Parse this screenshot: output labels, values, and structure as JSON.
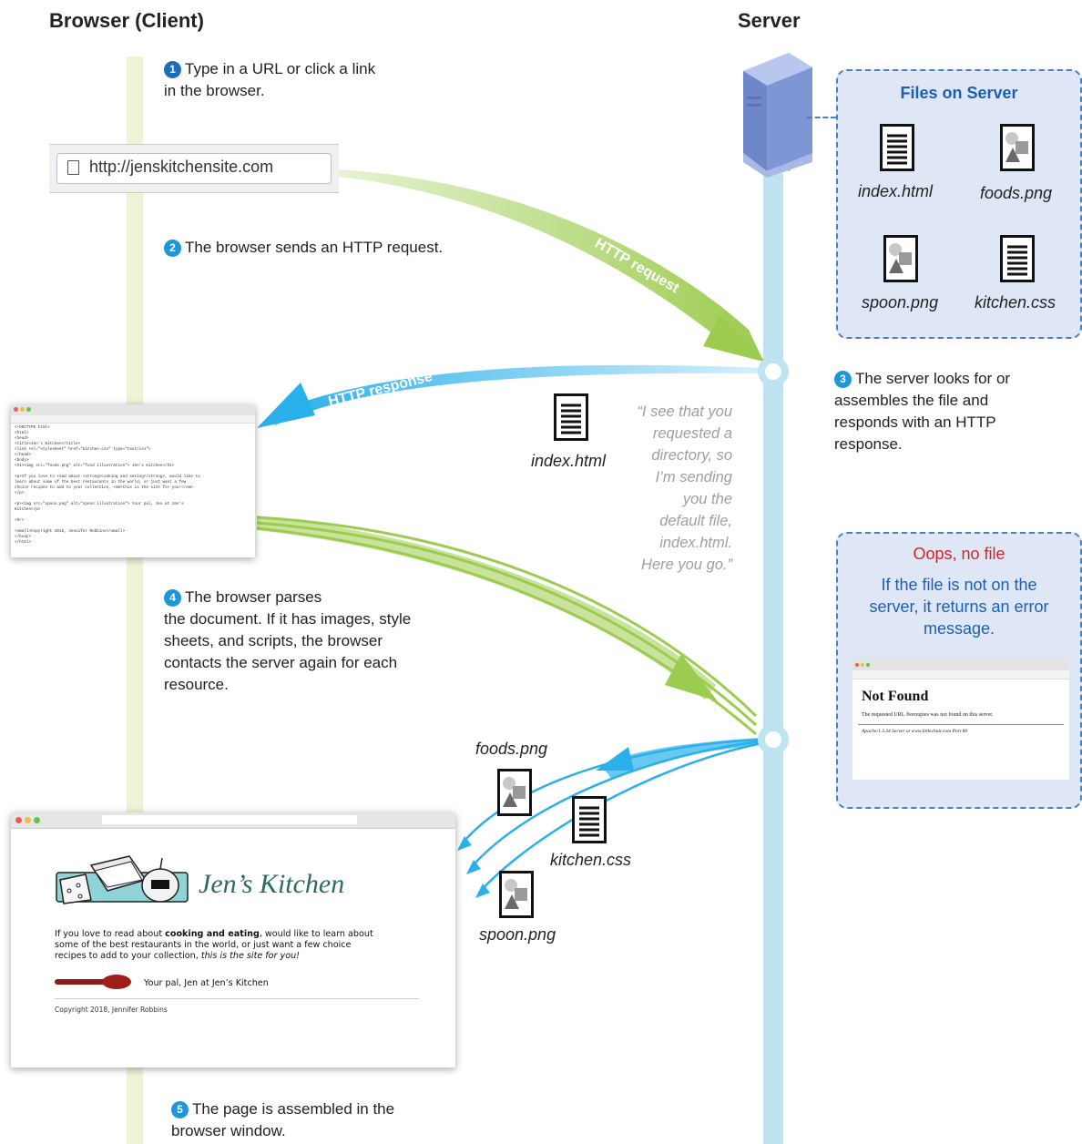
{
  "client_heading": "Browser (Client)",
  "server_heading": "Server",
  "steps": {
    "s1": {
      "num": "1",
      "text_a": "Type in a URL or click a link",
      "text_b": "in the browser."
    },
    "s2": {
      "num": "2",
      "text": "The browser sends an HTTP request."
    },
    "s3": {
      "num": "3",
      "lines": [
        "The server looks for or",
        "assembles  the file and",
        "responds with an HTTP",
        "response."
      ]
    },
    "s4": {
      "num": "4",
      "lines": [
        "The browser parses",
        "the document. If it has images, style",
        "sheets, and scripts, the browser",
        "contacts the server again for each",
        "resource."
      ]
    },
    "s5": {
      "num": "5",
      "text_a": "The page is assembled in the",
      "text_b": "browser window."
    }
  },
  "url_bar": {
    "prefix": "http://",
    "domain": "jenskitchensite.com"
  },
  "arrows": {
    "request": "HTTP request",
    "response": "HTTP response"
  },
  "files_box": {
    "title": "Files on Server",
    "files": [
      {
        "name": "index.html",
        "kind": "document-icon"
      },
      {
        "name": "foods.png",
        "kind": "image-icon"
      },
      {
        "name": "spoon.png",
        "kind": "image-icon"
      },
      {
        "name": "kitchen.css",
        "kind": "document-icon"
      }
    ]
  },
  "response_file": "index.html",
  "quote_lines": [
    "“I see that you",
    "requested a",
    "directory, so",
    "I’m sending",
    "you the",
    "default file,",
    "index.html.",
    "Here you go.”"
  ],
  "resources": {
    "foods": "foods.png",
    "kitchen": "kitchen.css",
    "spoon": "spoon.png"
  },
  "error_box": {
    "title": "Oops, no file",
    "lines": [
      "If the file is not on the",
      "server, it returns an error",
      "message."
    ],
    "page_title": "Not Found",
    "page_text": "The requested URL /boroupies was not found on this server.",
    "page_footer": "Apache/1.3.34 Server at www.littlechair.com Port 80"
  },
  "code_lines": [
    "<!DOCTYPE html>",
    "<html>",
    "<head>",
    "  <title>Jen's Kitchen</title>",
    "  <link rel=\"stylesheet\" href=\"kitchen.css\" type=\"text/css\">",
    "</head>",
    "",
    "<body>",
    "<h1><img src=\"foods.png\" alt=\"food illustration\"> Jen's Kitchen</h1>",
    "",
    "<p>If you love to read about <strong>cooking and eating</strong>, would like to",
    "learn about some of the best restaurants in the world, or just want a few",
    "choice recipes to add to your collection, <em>this is the site for you!</em>",
    "</p>",
    "",
    "<p><img src=\"spoon.png\" alt=\"spoon illustration\"> Your pal, Jen at Jen's",
    "Kitchen</p>",
    "",
    "<hr>",
    "",
    "<small>Copyright 2018, Jennifer Robbins</small>",
    "</body>",
    "</html>"
  ],
  "final_page": {
    "title": "Jen’s Kitchen",
    "p1_a": "If you love to read about ",
    "p1_bold": "cooking and eating",
    "p1_b": ", would like to learn about",
    "p1_c": "some of the best restaurants in the world, or just want a few choice",
    "p1_d": "recipes to add to your collection, ",
    "p1_em": "this is the site for you!",
    "signoff": "Your pal, Jen at Jen’s Kitchen",
    "copyright": "Copyright 2018, Jennifer Robbins"
  },
  "colors": {
    "request_arrow": "#9ccc4f",
    "response_arrow": "#2ab0ea",
    "client_line": "#eef3d6",
    "server_line": "#bfe4f1",
    "box_fill": "#dfe6f5",
    "box_border": "#4a7fc0",
    "error_red": "#d0262b",
    "title_blue": "#1f5fb0",
    "kitchen_teal": "#2a6b66"
  }
}
